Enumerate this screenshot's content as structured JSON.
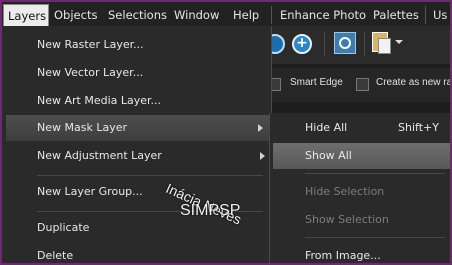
{
  "menubar": {
    "items": [
      {
        "label": "Layers"
      },
      {
        "label": "Objects"
      },
      {
        "label": "Selections"
      },
      {
        "label": "Window"
      },
      {
        "label": "Help"
      },
      {
        "label": "Enhance Photo"
      },
      {
        "label": "Palettes"
      },
      {
        "label": "Us"
      }
    ]
  },
  "layers_menu": {
    "items": [
      {
        "label": "New Raster Layer...",
        "has_submenu": false
      },
      {
        "label": "New Vector Layer...",
        "has_submenu": false
      },
      {
        "label": "New Art Media Layer...",
        "has_submenu": false
      },
      {
        "label": "New Mask Layer",
        "has_submenu": true,
        "highlighted": true
      },
      {
        "label": "New Adjustment Layer",
        "has_submenu": true
      },
      {
        "label": "New Layer Group...",
        "has_submenu": false
      },
      {
        "label": "Duplicate",
        "has_submenu": false
      },
      {
        "label": "Delete",
        "has_submenu": false
      }
    ]
  },
  "mask_submenu": {
    "items": [
      {
        "label": "Hide All",
        "shortcut": "Shift+Y",
        "enabled": true
      },
      {
        "label": "Show All",
        "shortcut": "",
        "enabled": true,
        "highlighted": true
      },
      {
        "label": "Hide Selection",
        "shortcut": "",
        "enabled": false
      },
      {
        "label": "Show Selection",
        "shortcut": "",
        "enabled": false
      },
      {
        "label": "From Image...",
        "shortcut": "",
        "enabled": true
      }
    ]
  },
  "options_bar": {
    "smart_edge_label": "Smart Edge",
    "create_as_new_label": "Create as new ras"
  },
  "watermark": {
    "line1": "Inácia Neves",
    "line2": "SIMPSP"
  },
  "colors": {
    "border": "#6b2c6e",
    "menu_bg": "#2a2a2a",
    "highlight": "#5f5f5f"
  }
}
